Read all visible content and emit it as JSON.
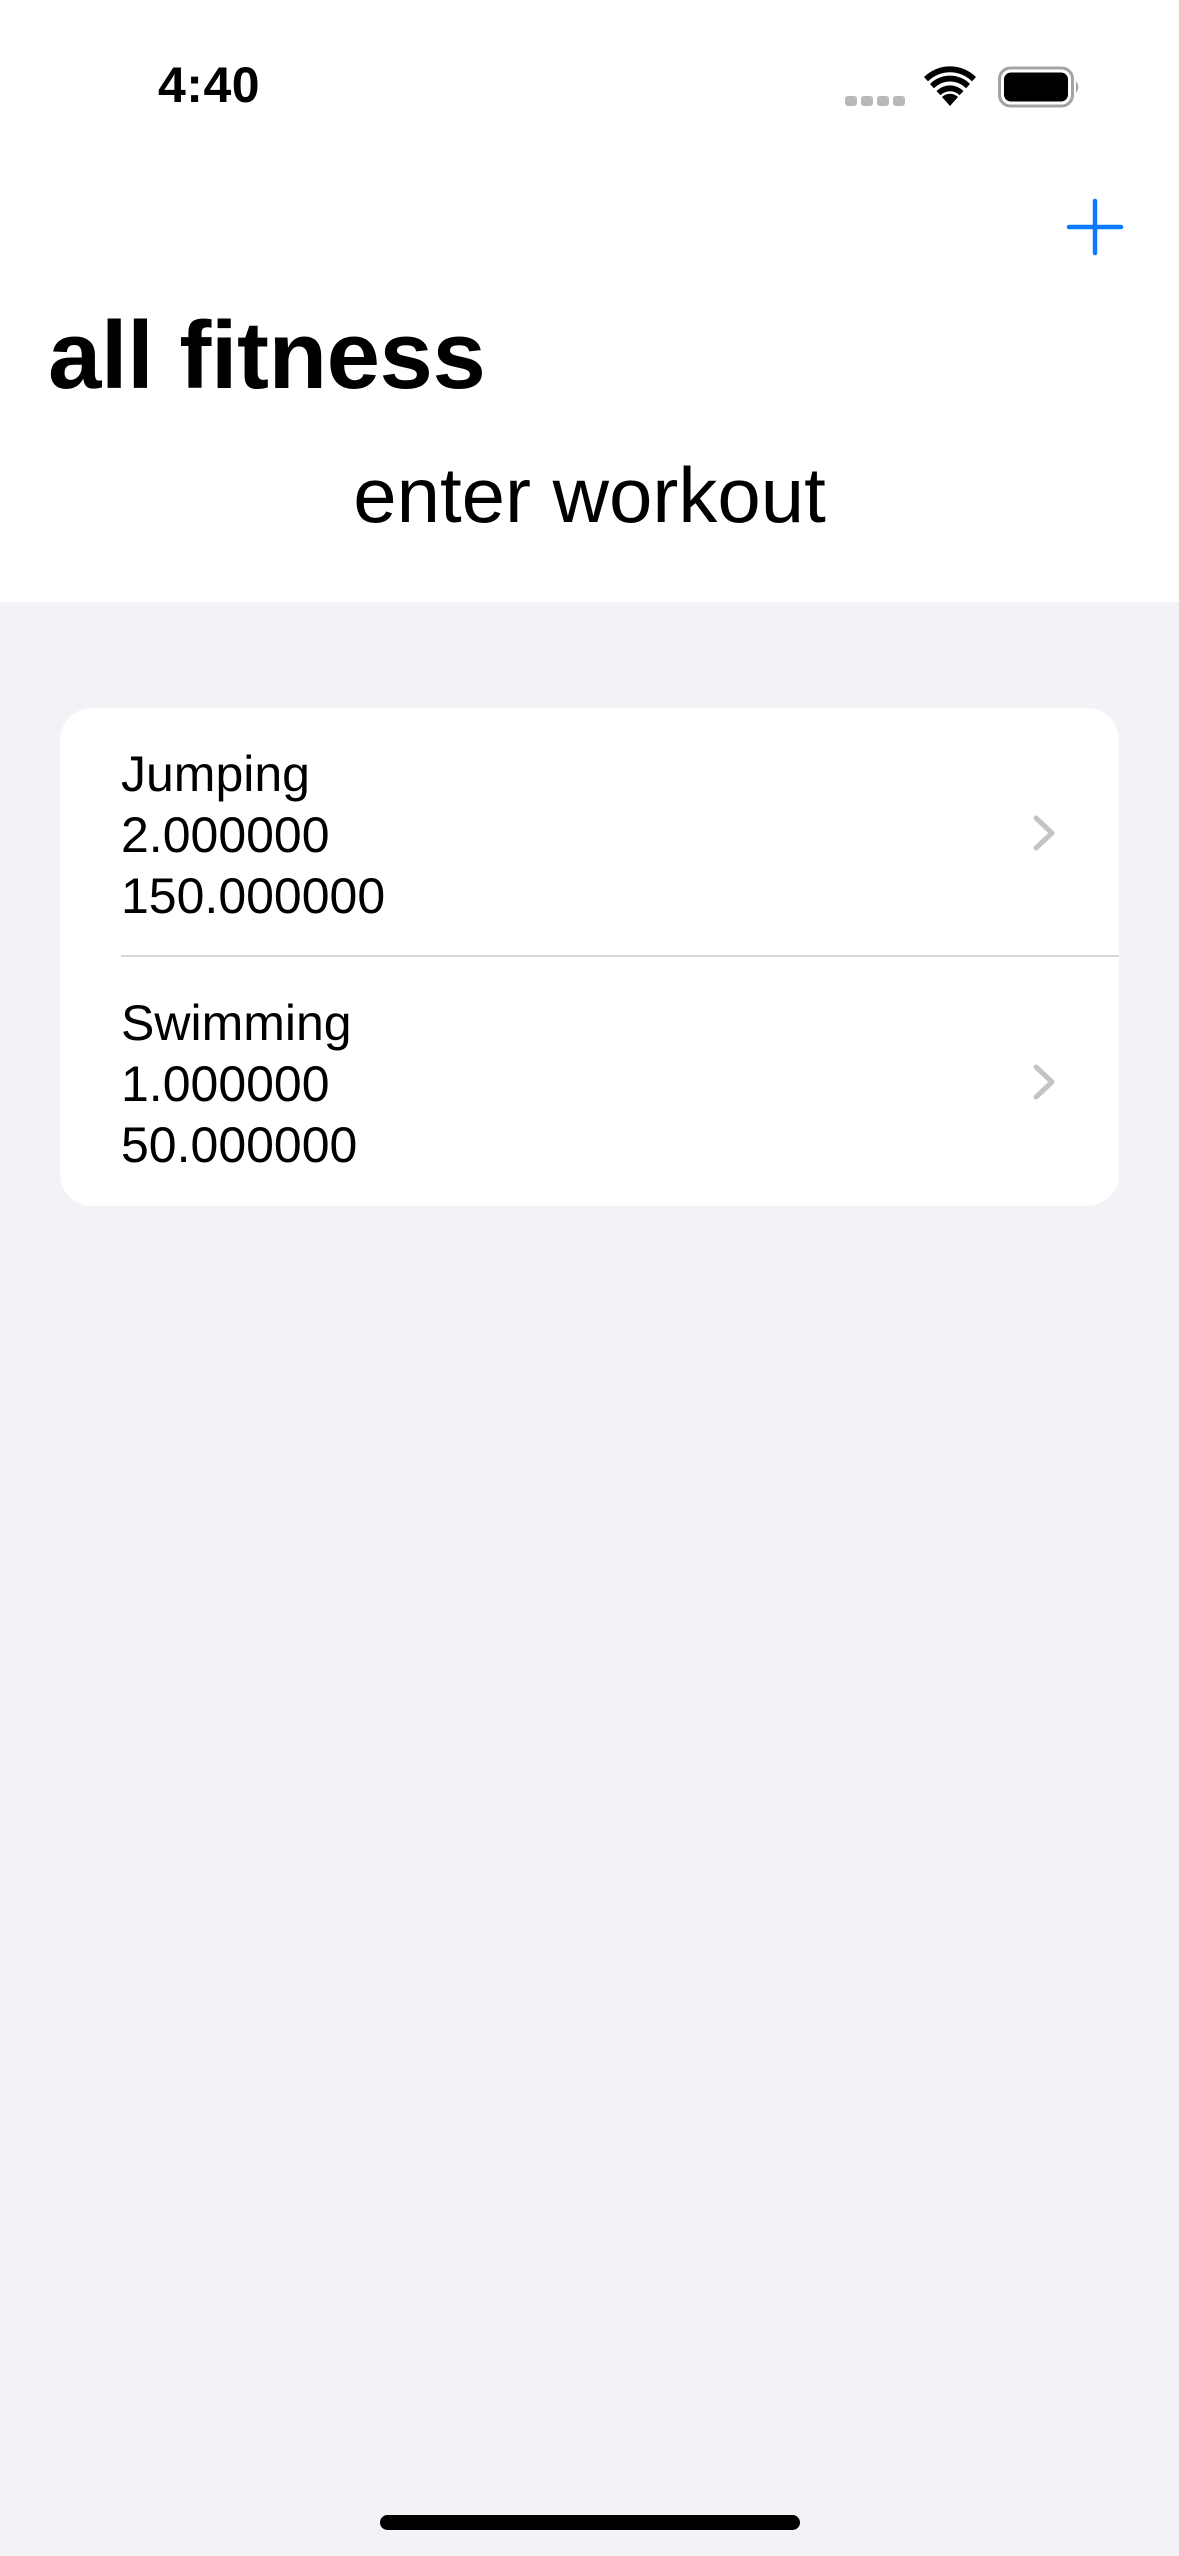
{
  "status_bar": {
    "time": "4:40"
  },
  "nav": {
    "add_icon": "plus-icon",
    "title": "all fitness",
    "enter_workout_label": "enter workout"
  },
  "workouts": [
    {
      "name": "Jumping",
      "value_1": "2.000000",
      "value_2": "150.000000"
    },
    {
      "name": "Swimming",
      "value_1": "1.000000",
      "value_2": "50.000000"
    }
  ],
  "colors": {
    "accent": "#0a7aff",
    "background": "#f2f2f7",
    "card": "#ffffff",
    "chevron": "#c4c4c7"
  }
}
